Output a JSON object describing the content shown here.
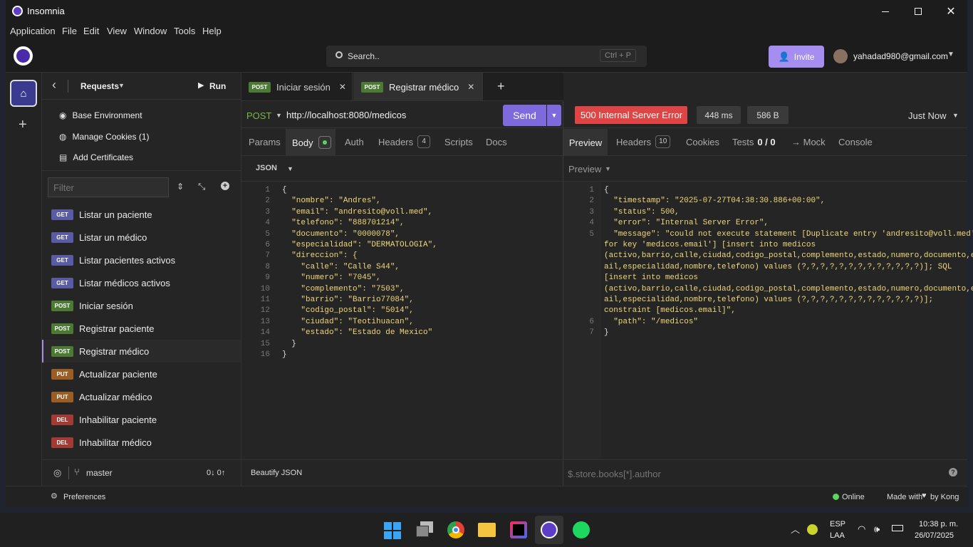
{
  "window": {
    "title": "Insomnia",
    "minimize": "—",
    "maximize": "☐",
    "close": "✕"
  },
  "menu": [
    "Application",
    "File",
    "Edit",
    "View",
    "Window",
    "Tools",
    "Help"
  ],
  "appbar": {
    "search_label": "Search..",
    "search_shortcut": "Ctrl + P",
    "invite_label": "Invite",
    "user_email": "yahadad980@gmail.com"
  },
  "sidebar": {
    "back": "‹",
    "title": "Requests",
    "run_label": "Run",
    "links": [
      "Base Environment",
      "Manage Cookies (1)",
      "Add Certificates"
    ],
    "filter_placeholder": "Filter",
    "requests": [
      {
        "method": "GET",
        "label": "Listar un paciente"
      },
      {
        "method": "GET",
        "label": "Listar un médico"
      },
      {
        "method": "GET",
        "label": "Listar pacientes activos"
      },
      {
        "method": "GET",
        "label": "Listar médicos activos"
      },
      {
        "method": "POST",
        "label": "Iniciar sesión"
      },
      {
        "method": "POST",
        "label": "Registrar paciente"
      },
      {
        "method": "POST",
        "label": "Registrar médico"
      },
      {
        "method": "PUT",
        "label": "Actualizar paciente"
      },
      {
        "method": "PUT",
        "label": "Actualizar médico"
      },
      {
        "method": "DEL",
        "label": "Inhabilitar paciente"
      },
      {
        "method": "DEL",
        "label": "Inhabilitar médico"
      }
    ],
    "branch": "master",
    "sync": "0↓ 0↑"
  },
  "tabs": [
    {
      "method": "POST",
      "label": "Iniciar sesión"
    },
    {
      "method": "POST",
      "label": "Registrar médico"
    }
  ],
  "request": {
    "method": "POST",
    "url": "http://localhost:8080/medicos",
    "send_label": "Send",
    "subtabs": {
      "params": "Params",
      "body": "Body",
      "auth": "Auth",
      "headers": "Headers",
      "headers_count": "4",
      "scripts": "Scripts",
      "docs": "Docs"
    },
    "body_type": "JSON",
    "beautify_label": "Beautify JSON",
    "body_lines": [
      {
        "n": "1",
        "t": "{"
      },
      {
        "n": "2",
        "t": "  \"nombre\": \"Andres\","
      },
      {
        "n": "3",
        "t": "  \"email\": \"andresito@voll.med\","
      },
      {
        "n": "4",
        "t": "  \"telefono\": \"888701214\","
      },
      {
        "n": "5",
        "t": "  \"documento\": \"0000078\","
      },
      {
        "n": "6",
        "t": "  \"especialidad\": \"DERMATOLOGIA\","
      },
      {
        "n": "7",
        "t": "  \"direccion\": {"
      },
      {
        "n": "8",
        "t": "    \"calle\": \"Calle S44\","
      },
      {
        "n": "9",
        "t": "    \"numero\": \"7045\","
      },
      {
        "n": "10",
        "t": "    \"complemento\": \"7503\","
      },
      {
        "n": "11",
        "t": "    \"barrio\": \"Barrio77084\","
      },
      {
        "n": "12",
        "t": "    \"codigo_postal\": \"5014\","
      },
      {
        "n": "13",
        "t": "    \"ciudad\": \"Teotihuacan\","
      },
      {
        "n": "14",
        "t": "    \"estado\": \"Estado de Mexico\""
      },
      {
        "n": "15",
        "t": "  }"
      },
      {
        "n": "16",
        "t": "}"
      }
    ]
  },
  "response": {
    "status": "500 Internal Server Error",
    "time": "448 ms",
    "size": "586 B",
    "when": "Just Now",
    "subtabs": {
      "preview": "Preview",
      "headers": "Headers",
      "headers_count": "10",
      "cookies": "Cookies",
      "tests": "Tests",
      "tests_count": "0 / 0",
      "mock": "→ Mock",
      "console": "Console"
    },
    "preview_mode": "Preview",
    "filter_placeholder": "$.store.books[*].author",
    "lines": [
      {
        "n": "1",
        "t": "{"
      },
      {
        "n": "2",
        "t": "  \"timestamp\": \"2025-07-27T04:38:30.886+00:00\","
      },
      {
        "n": "3",
        "t": "  \"status\": 500,"
      },
      {
        "n": "4",
        "t": "  \"error\": \"Internal Server Error\","
      },
      {
        "n": "5",
        "t": "  \"message\": \"could not execute statement [Duplicate entry 'andresito@voll.med'"
      },
      {
        "n": "",
        "t": "for key 'medicos.email'] [insert into medicos"
      },
      {
        "n": "",
        "t": "(activo,barrio,calle,ciudad,codigo_postal,complemento,estado,numero,documento,em"
      },
      {
        "n": "",
        "t": "ail,especialidad,nombre,telefono) values (?,?,?,?,?,?,?,?,?,?,?,?,?)]; SQL"
      },
      {
        "n": "",
        "t": "[insert into medicos"
      },
      {
        "n": "",
        "t": "(activo,barrio,calle,ciudad,codigo_postal,complemento,estado,numero,documento,em"
      },
      {
        "n": "",
        "t": "ail,especialidad,nombre,telefono) values (?,?,?,?,?,?,?,?,?,?,?,?,?)];"
      },
      {
        "n": "",
        "t": "constraint [medicos.email]\","
      },
      {
        "n": "6",
        "t": "  \"path\": \"/medicos\""
      },
      {
        "n": "7",
        "t": "}"
      }
    ]
  },
  "statusbar": {
    "preferences": "Preferences",
    "online": "Online",
    "made_with": "Made with",
    "by_kong": "by Kong"
  },
  "taskbar": {
    "lang": "ESP",
    "layout": "LAA",
    "time": "10:38 p. m.",
    "date": "26/07/2025"
  },
  "colors": {
    "accent": "#6e57d6",
    "send": "#7e69dd",
    "error": "#e04545",
    "invite": "#a58ef0"
  }
}
